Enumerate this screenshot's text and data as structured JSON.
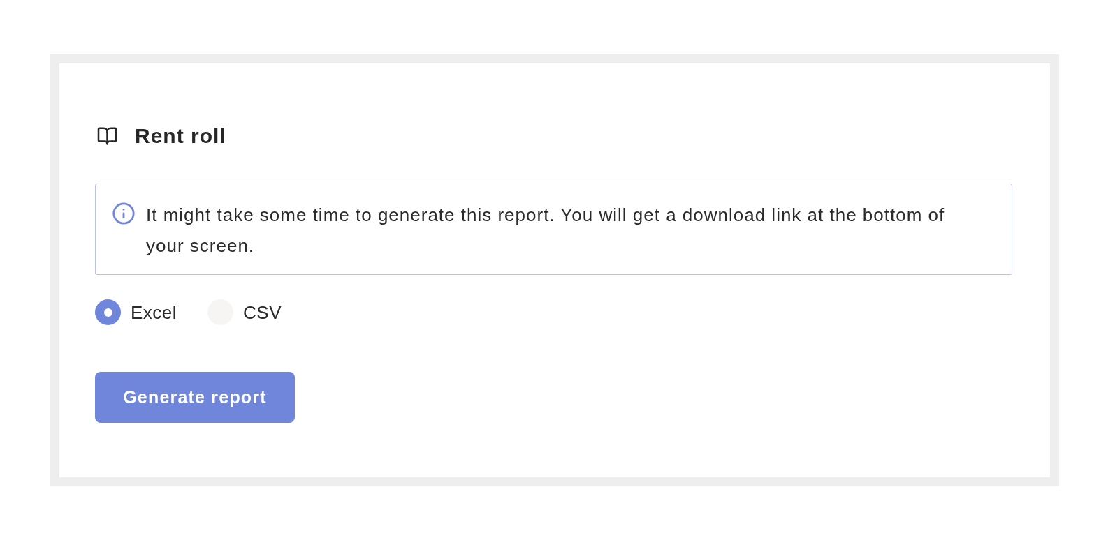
{
  "report": {
    "title": "Rent roll",
    "notice": "It might take some time to generate this report. You will get a download link at the bottom of your screen.",
    "formats": [
      {
        "label": "Excel",
        "selected": true
      },
      {
        "label": "CSV",
        "selected": false
      }
    ],
    "button": "Generate report"
  }
}
